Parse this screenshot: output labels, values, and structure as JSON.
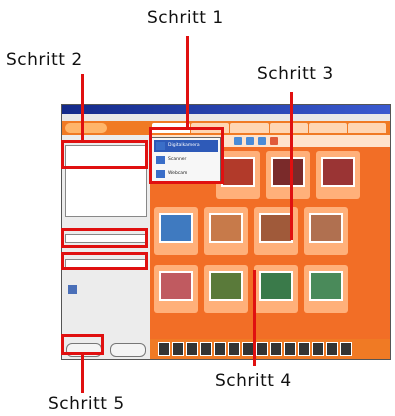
{
  "callouts": {
    "step1": "Schritt 1",
    "step2": "Schritt 2",
    "step3": "Schritt 3",
    "step4": "Schritt 4",
    "step5": "Schritt 5"
  },
  "dropdown_items": [
    "Digitalkamera",
    "Scanner",
    "Webcam"
  ],
  "colors": {
    "highlight": "#e01010",
    "app_orange": "#f07a24"
  }
}
